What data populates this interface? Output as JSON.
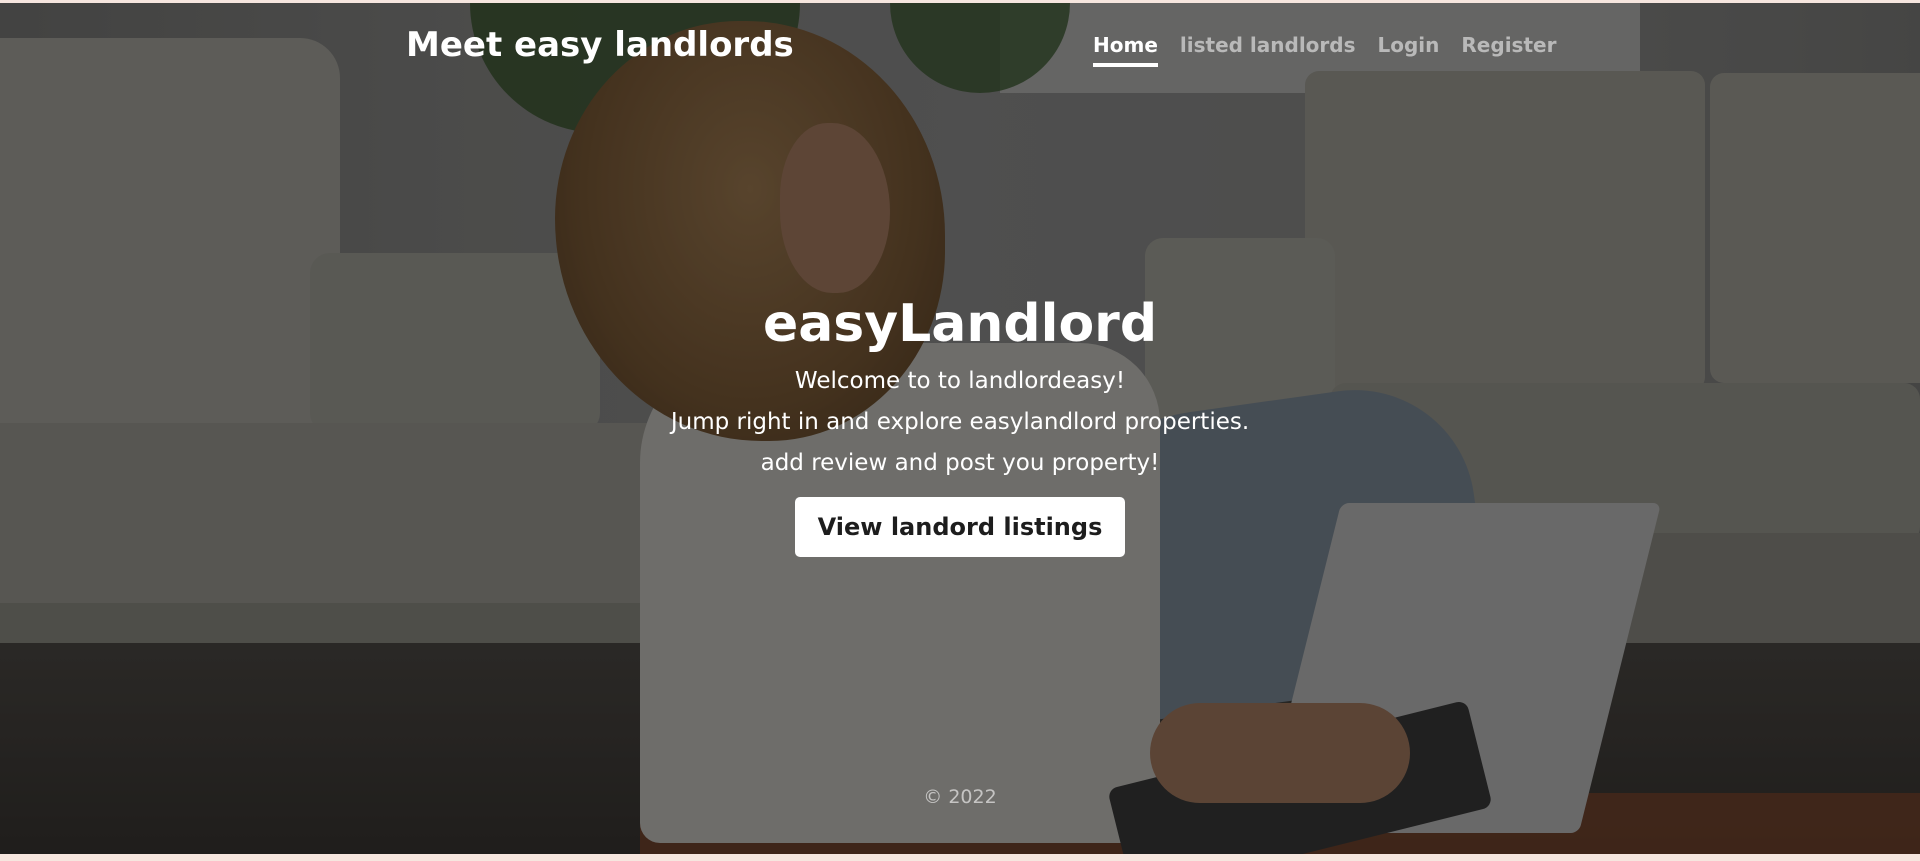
{
  "header": {
    "brand": "Meet easy landlords",
    "nav": [
      {
        "label": "Home",
        "active": true
      },
      {
        "label": "listed landlords",
        "active": false
      },
      {
        "label": "Login",
        "active": false
      },
      {
        "label": "Register",
        "active": false
      }
    ]
  },
  "hero": {
    "title": "easyLandlord",
    "lines": [
      "Welcome to to landlordeasy!",
      "Jump right in and explore easylandlord properties.",
      "add review and post you property!"
    ],
    "cta_label": "View landord listings"
  },
  "footer": {
    "text": "© 2022"
  },
  "colors": {
    "page_bottom": "#f6e6df",
    "cta_bg": "#ffffff",
    "cta_text": "#1d1d1d"
  }
}
